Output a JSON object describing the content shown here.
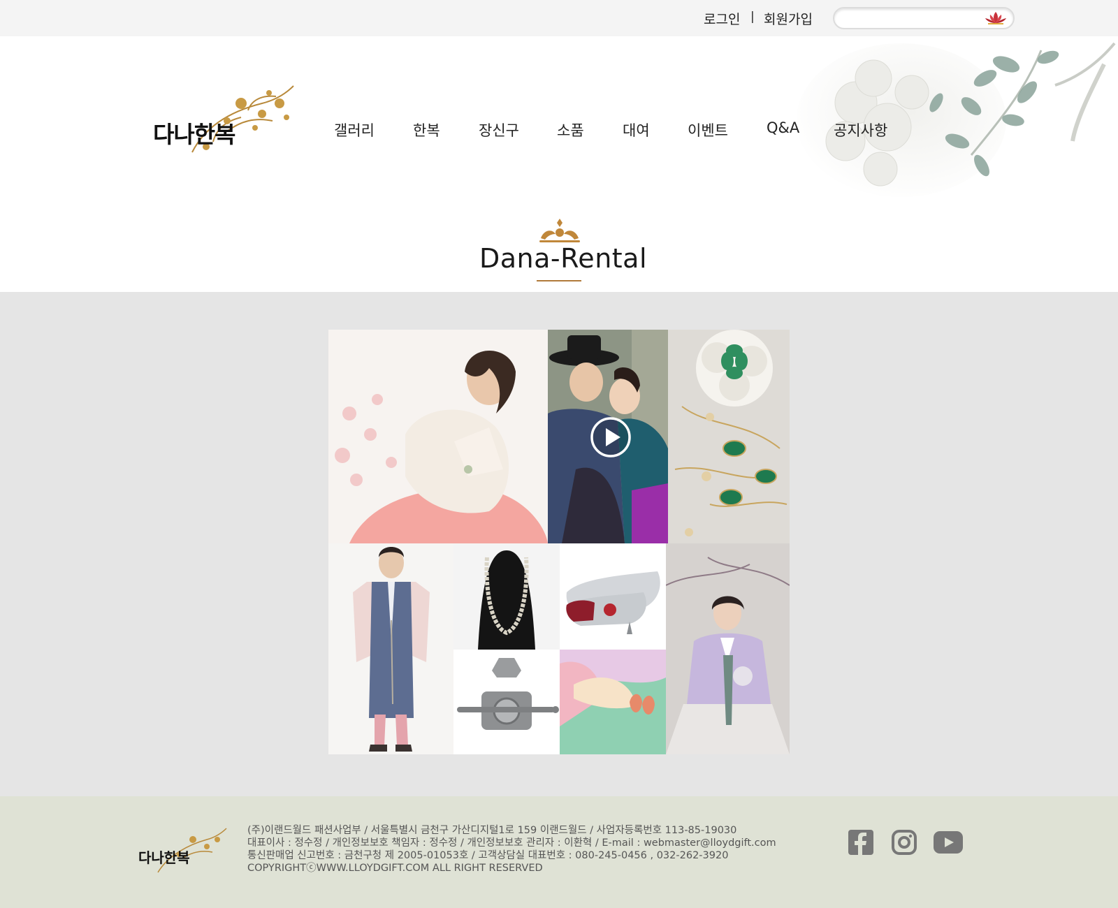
{
  "colors": {
    "topbar_bg": "#f4f4f4",
    "gallery_bg": "#e5e5e5",
    "footer_bg": "#dfe2d5",
    "accent_gold": "#b07a3a",
    "social_icon": "#777777"
  },
  "topbar": {
    "login_label": "로그인",
    "separator": "|",
    "join_label": "회원가입",
    "search_placeholder": "",
    "search_icon": "lotus-icon"
  },
  "header": {
    "logo_text": "다나한복",
    "nav": [
      "갤러리",
      "한복",
      "장신구",
      "소품",
      "대여",
      "이벤트",
      "Q&A",
      "공지사항"
    ]
  },
  "section": {
    "title": "Dana-Rental"
  },
  "gallery": {
    "tiles": [
      {
        "name": "woman-pink-hanbok-photo"
      },
      {
        "name": "wedding-couple-video-thumbnail",
        "icon": "play-icon"
      },
      {
        "name": "green-gem-necklace-photo"
      },
      {
        "name": "man-blue-hanbok-photo"
      },
      {
        "name": "pearl-necklace-photo"
      },
      {
        "name": "embroidered-shoes-photo"
      },
      {
        "name": "silver-ornament-photo"
      },
      {
        "name": "hanbok-fabric-photo"
      },
      {
        "name": "woman-lavender-hanbok-photo"
      }
    ]
  },
  "footer": {
    "logo_text": "다나한복",
    "lines": [
      "(주)이랜드월드 패션사업부 / 서울특별시 금천구 가산디지털1로 159 이랜드월드 / 사업자등록번호 113-85-19030",
      "대표이사 : 정수정 / 개인정보보호 책임자 : 정수정 / 개인정보보호 관리자 : 이환혁 / E-mail : webmaster@lloydgift.com",
      "통신판매업 신고번호 : 금천구청 제 2005-01053호 / 고객상담실 대표번호 : 080-245-0456 , 032-262-3920",
      " COPYRIGHTⓒWWW.LLOYDGIFT.COM ALL RIGHT RESERVED"
    ],
    "social": [
      "facebook-icon",
      "instagram-icon",
      "youtube-icon"
    ]
  }
}
